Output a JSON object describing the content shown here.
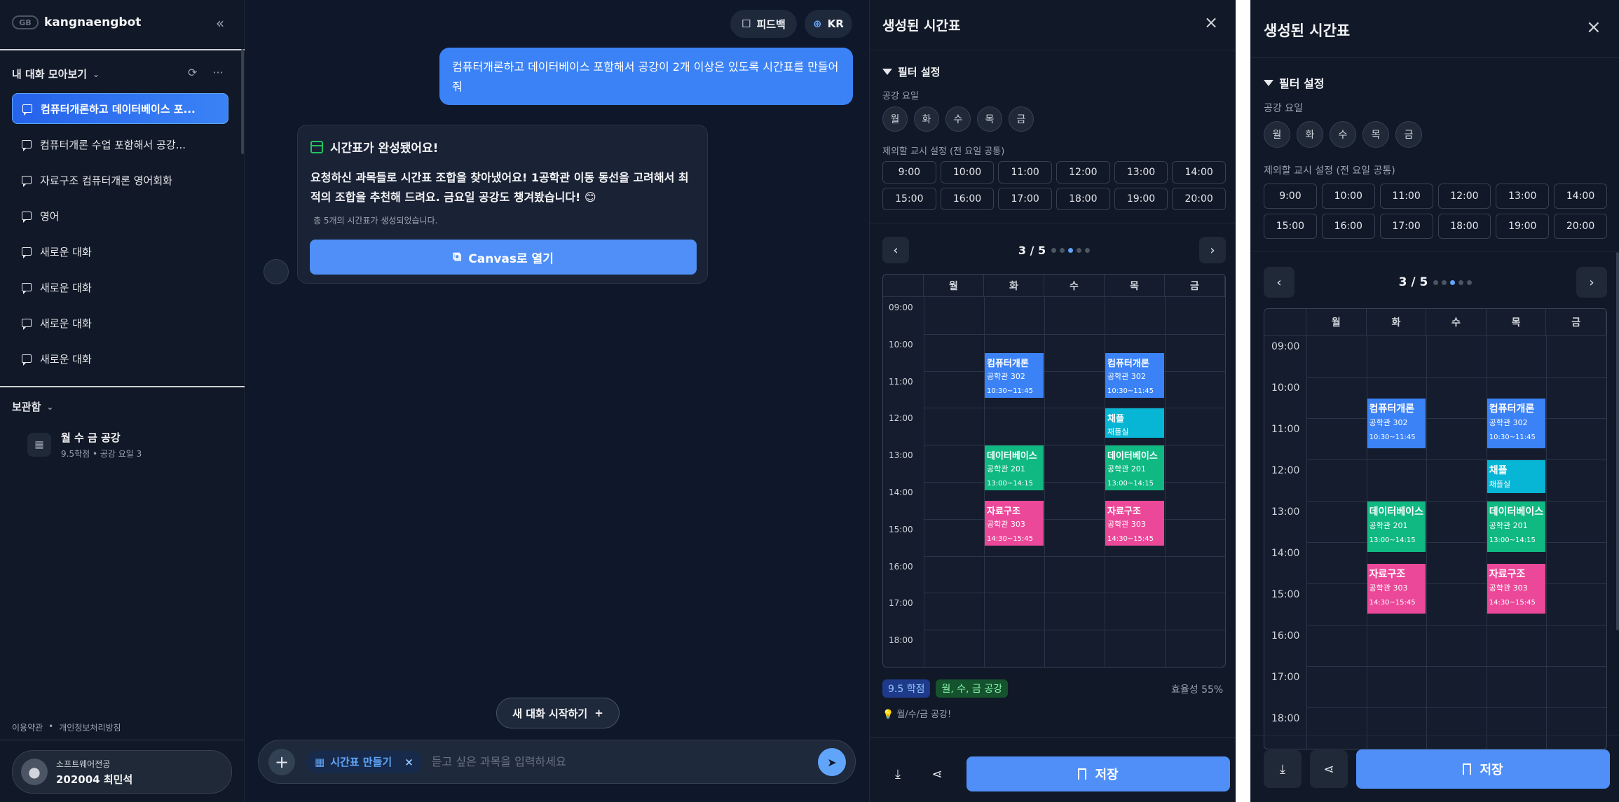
{
  "sidebar": {
    "brand": "kangnaengbot",
    "conversations_title": "내 대화 모아보기",
    "conversations": [
      "컴퓨터개론하고 데이터베이스 포...",
      "컴퓨터개론 수업 포함해서 공강...",
      "자료구조 컴퓨터개론 영어회화",
      "영어",
      "새로운 대화",
      "새로운 대화",
      "새로운 대화",
      "새로운 대화"
    ],
    "saved_title": "보관함",
    "saved": {
      "title": "월 수 금 공강",
      "subtitle": "9.5학점 • 공강 요일 3"
    },
    "footer": {
      "terms": "이용약관",
      "separator": "•",
      "privacy": "개인정보처리방침"
    },
    "user": {
      "major": "소프트웨어전공",
      "id_name": "202004 최민석"
    }
  },
  "chat": {
    "feedback": "피드백",
    "language": "KR",
    "user_message": "컴퓨터개론하고 데이터베이스 포함해서 공강이 2개 이상은 있도록 시간표를 만들어줘",
    "bot_title": "시간표가 완성됐어요!",
    "bot_text": "요청하신 과목들로 시간표 조합을 찾아냈어요! 1공학관 이동 동선을 고려해서 최적의 조합을 추천해 드려요. 금요일 공강도 챙겨봤습니다! 😊",
    "bot_note": "총 5개의 시간표가 생성되었습니다.",
    "canvas_button": "Canvas로 열기",
    "new_chat": "새 대화 시작하기",
    "chip": "시간표 만들기",
    "input_placeholder": "듣고 싶은 과목을 입력하세요"
  },
  "timetable": {
    "title": "생성된 시간표",
    "filter_title": "필터 설정",
    "free_day_label": "공강 요일",
    "days": [
      "월",
      "화",
      "수",
      "목",
      "금"
    ],
    "exclude_label": "제외할 교시 설정 (전 요일 공통)",
    "hours": [
      "9:00",
      "10:00",
      "11:00",
      "12:00",
      "13:00",
      "14:00",
      "15:00",
      "16:00",
      "17:00",
      "18:00",
      "19:00",
      "20:00"
    ],
    "page": "3 / 5",
    "page_count": 5,
    "page_current": 3,
    "time_labels": [
      "09:00",
      "10:00",
      "11:00",
      "12:00",
      "13:00",
      "14:00",
      "15:00",
      "16:00",
      "17:00",
      "18:00"
    ],
    "blocks": [
      {
        "day": 1,
        "start": 10.5,
        "end": 11.75,
        "name": "컴퓨터개론",
        "room": "공학관 302",
        "time": "10:30~11:45",
        "color": "#3b82f6"
      },
      {
        "day": 3,
        "start": 10.5,
        "end": 11.75,
        "name": "컴퓨터개론",
        "room": "공학관 302",
        "time": "10:30~11:45",
        "color": "#3b82f6"
      },
      {
        "day": 3,
        "start": 12.0,
        "end": 12.83,
        "name": "채플",
        "room": "채플실",
        "time": "",
        "color": "#06b6d4"
      },
      {
        "day": 1,
        "start": 13.0,
        "end": 14.25,
        "name": "데이터베이스",
        "room": "공학관 201",
        "time": "13:00~14:15",
        "color": "#10b981"
      },
      {
        "day": 3,
        "start": 13.0,
        "end": 14.25,
        "name": "데이터베이스",
        "room": "공학관 201",
        "time": "13:00~14:15",
        "color": "#10b981"
      },
      {
        "day": 1,
        "start": 14.5,
        "end": 15.75,
        "name": "자료구조",
        "room": "공학관 303",
        "time": "14:30~15:45",
        "color": "#ec4899"
      },
      {
        "day": 3,
        "start": 14.5,
        "end": 15.75,
        "name": "자료구조",
        "room": "공학관 303",
        "time": "14:30~15:45",
        "color": "#ec4899"
      }
    ],
    "credits": "9.5 학점",
    "free_days": "월, 수, 금 공강",
    "efficiency": "효율성 55%",
    "hint": "💡 월/수/금 공강!",
    "save": "저장"
  }
}
